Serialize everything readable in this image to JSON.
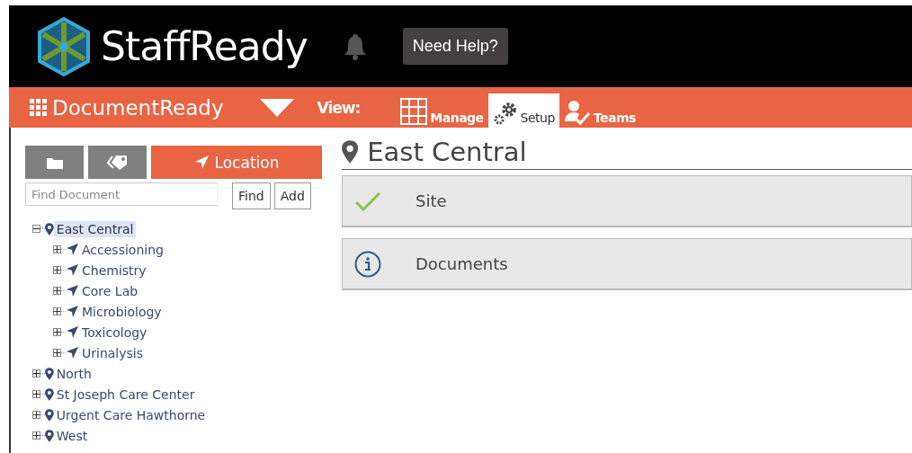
{
  "header": {
    "brand": "StaffReady",
    "help_button": "Need Help?"
  },
  "navbar": {
    "app_name": "DocumentReady",
    "view_label": "View:",
    "tabs": [
      {
        "label": "Manage",
        "kind": "grid",
        "selected": false
      },
      {
        "label": "Setup",
        "kind": "gears",
        "selected": true
      },
      {
        "label": "Teams",
        "kind": "user-check",
        "selected": false
      }
    ]
  },
  "sidebar": {
    "tabs": [
      {
        "kind": "folder",
        "selected": false
      },
      {
        "kind": "tag",
        "selected": false
      },
      {
        "kind": "location",
        "label": "Location",
        "selected": true
      }
    ],
    "search": {
      "placeholder": "Find Document"
    },
    "buttons": [
      "Find",
      "Add"
    ],
    "tree": [
      {
        "label": "East Central",
        "kind": "site",
        "expanded": true,
        "selected": true,
        "children": [
          {
            "label": "Accessioning",
            "kind": "department",
            "expanded": false,
            "selected": false
          },
          {
            "label": "Chemistry",
            "kind": "department",
            "expanded": false,
            "selected": false
          },
          {
            "label": "Core Lab",
            "kind": "department",
            "expanded": false,
            "selected": false
          },
          {
            "label": "Microbiology",
            "kind": "department",
            "expanded": false,
            "selected": false
          },
          {
            "label": "Toxicology",
            "kind": "department",
            "expanded": false,
            "selected": false
          },
          {
            "label": "Urinalysis",
            "kind": "department",
            "expanded": false,
            "selected": false
          }
        ]
      },
      {
        "label": "North",
        "kind": "site",
        "expanded": false,
        "selected": false
      },
      {
        "label": "St Joseph Care Center",
        "kind": "site",
        "expanded": false,
        "selected": false
      },
      {
        "label": "Urgent Care Hawthorne",
        "kind": "site",
        "expanded": false,
        "selected": false
      },
      {
        "label": "West",
        "kind": "site",
        "expanded": false,
        "selected": false
      }
    ]
  },
  "content": {
    "title": "East Central",
    "panels": [
      {
        "label": "Site",
        "kind": "complete"
      },
      {
        "label": "Documents",
        "kind": "info"
      }
    ]
  }
}
